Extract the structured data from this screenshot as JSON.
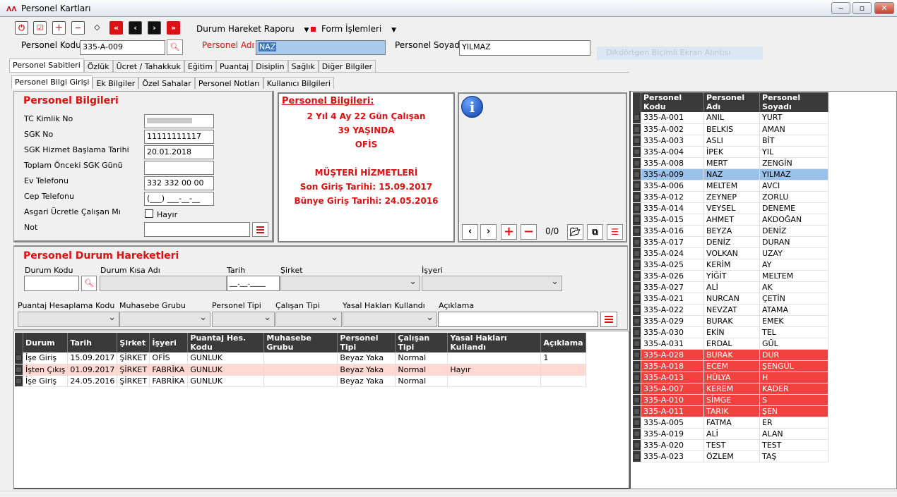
{
  "window": {
    "title": "Personel Kartları"
  },
  "toolbar": {
    "menu1": "Durum Hareket Raporu",
    "menu2": "Form İşlemleri"
  },
  "header": {
    "kod_label": "Personel Kodu",
    "kod_value": "335-A-009",
    "ad_label": "Personel Adı",
    "ad_value": "NAZ",
    "soyad_label": "Personel Soyadı",
    "soyad_value": "YILMAZ",
    "ghost": "Dikdörtgen Biçimli Ekran Alıntısı"
  },
  "tabs": [
    "Personel Sabitleri",
    "Özlük",
    "Ücret / Tahakkuk",
    "Eğitim",
    "Puantaj",
    "Disiplin",
    "Sağlık",
    "Diğer Bilgiler"
  ],
  "subtabs": [
    "Personel Bilgi Girişi",
    "Ek Bilgiler",
    "Özel Sahalar",
    "Personel Notları",
    "Kullanıcı Bilgileri"
  ],
  "bilgi": {
    "title": "Personel Bilgileri",
    "tc_label": "TC Kimlik No",
    "sgk_label": "SGK No",
    "sgk_value": "11111111117",
    "hizmet_label": "SGK Hizmet Başlama Tarihi",
    "hizmet_value": "20.01.2018",
    "onceki_label": "Toplam Önceki SGK Günü",
    "ev_label": "Ev Telefonu",
    "ev_value": "332 332 00 00",
    "cep_label": "Cep Telefonu",
    "cep_value": "(___) ___-__-__",
    "asgari_label": "Asgari Ücretle Çalışan Mı",
    "asgari_value": "Hayır",
    "not_label": "Not"
  },
  "info": {
    "title": "Personel Bilgileri:",
    "line1": "2 Yıl 4 Ay 22 Gün Çalışan",
    "line2": "39 YAŞINDA",
    "line3": "OFİS",
    "line4": "MÜŞTERİ HİZMETLERİ",
    "line5": "Son Giriş Tarihi: 15.09.2017",
    "line6": "Bünye Giriş Tarihi: 24.05.2016"
  },
  "photo": {
    "counter": "0/0"
  },
  "durum": {
    "title": "Personel Durum Hareketleri",
    "kod": "Durum Kodu",
    "kisa": "Durum Kısa Adı",
    "tarih": "Tarih",
    "tarih_value": "__.__.____",
    "sirket": "Şirket",
    "isyeri": "İşyeri",
    "puantaj": "Puantaj Hesaplama Kodu",
    "muhasebe": "Muhasebe Grubu",
    "ptip": "Personel Tipi",
    "ctip": "Çalışan Tipi",
    "yasal": "Yasal Hakları Kullandı",
    "aciklama": "Açıklama"
  },
  "hareket": {
    "columns": [
      "Durum",
      "Tarih",
      "Şirket",
      "İşyeri",
      "Puantaj Hes. Kodu",
      "Muhasebe Grubu",
      "Personel Tipi",
      "Çalışan Tipi",
      "Yasal Hakları Kullandı",
      "Açıklama"
    ],
    "rows": [
      [
        "İşe Giriş",
        "15.09.2017",
        "ŞİRKET",
        "OFİS",
        "GUNLUK",
        "",
        "Beyaz Yaka",
        "Normal",
        "",
        "1"
      ],
      [
        "İşten Çıkış",
        "01.09.2017",
        "ŞİRKET",
        "FABRİKA",
        "GUNLUK",
        "",
        "Beyaz Yaka",
        "Normal",
        "Hayır",
        ""
      ],
      [
        "İşe Giriş",
        "24.05.2016",
        "ŞİRKET",
        "FABRİKA",
        "GUNLUK",
        "",
        "Beyaz Yaka",
        "Normal",
        "",
        ""
      ]
    ]
  },
  "list": {
    "columns": [
      "Personel Kodu",
      "Personel Adı",
      "Personel Soyadı"
    ],
    "rows": [
      [
        "335-A-001",
        "ANIL",
        "YURT",
        "n"
      ],
      [
        "335-A-002",
        "BELKIS",
        "AMAN",
        "n"
      ],
      [
        "335-A-003",
        "ASLI",
        "BİT",
        "n"
      ],
      [
        "335-A-004",
        "İPEK",
        "YIL",
        "n"
      ],
      [
        "335-A-008",
        "MERT",
        "ZENGİN",
        "n"
      ],
      [
        "335-A-009",
        "NAZ",
        "YILMAZ",
        "s"
      ],
      [
        "335-A-006",
        "MELTEM",
        "AVCI",
        "n"
      ],
      [
        "335-A-012",
        "ZEYNEP",
        "ZORLU",
        "n"
      ],
      [
        "335-A-014",
        "VEYSEL",
        "DENEME",
        "n"
      ],
      [
        "335-A-015",
        "AHMET",
        "AKDOĞAN",
        "n"
      ],
      [
        "335-A-016",
        "BEYZA",
        "DENİZ",
        "n"
      ],
      [
        "335-A-017",
        "DENİZ",
        "DURAN",
        "n"
      ],
      [
        "335-A-024",
        "VOLKAN",
        "UZAY",
        "n"
      ],
      [
        "335-A-025",
        "KERİM",
        "AY",
        "n"
      ],
      [
        "335-A-026",
        "YİĞİT",
        "MELTEM",
        "n"
      ],
      [
        "335-A-027",
        "ALİ",
        "AK",
        "n"
      ],
      [
        "335-A-021",
        "NURCAN",
        "ÇETİN",
        "n"
      ],
      [
        "335-A-022",
        "NEVZAT",
        "ATAMA",
        "n"
      ],
      [
        "335-A-029",
        "BURAK",
        "EMEK",
        "n"
      ],
      [
        "335-A-030",
        "EKİN",
        "TEL",
        "n"
      ],
      [
        "335-A-031",
        "ERDAL",
        "GÜL",
        "n"
      ],
      [
        "335-A-028",
        "BURAK",
        "DUR",
        "r"
      ],
      [
        "335-A-018",
        "ECEM",
        "ŞENGÜL",
        "r"
      ],
      [
        "335-A-013",
        "HÜLYA",
        "H",
        "r"
      ],
      [
        "335-A-007",
        "KEREM",
        "KADER",
        "r"
      ],
      [
        "335-A-010",
        "SİMGE",
        "S",
        "r"
      ],
      [
        "335-A-011",
        "TARIK",
        "ŞEN",
        "r"
      ],
      [
        "335-A-005",
        "FATMA",
        "ER",
        "n"
      ],
      [
        "335-A-019",
        "ALİ",
        "ALAN",
        "n"
      ],
      [
        "335-A-020",
        "TEST",
        "TEST",
        "n"
      ],
      [
        "335-A-023",
        "ÖZLEM",
        "TAŞ",
        "n"
      ]
    ]
  }
}
